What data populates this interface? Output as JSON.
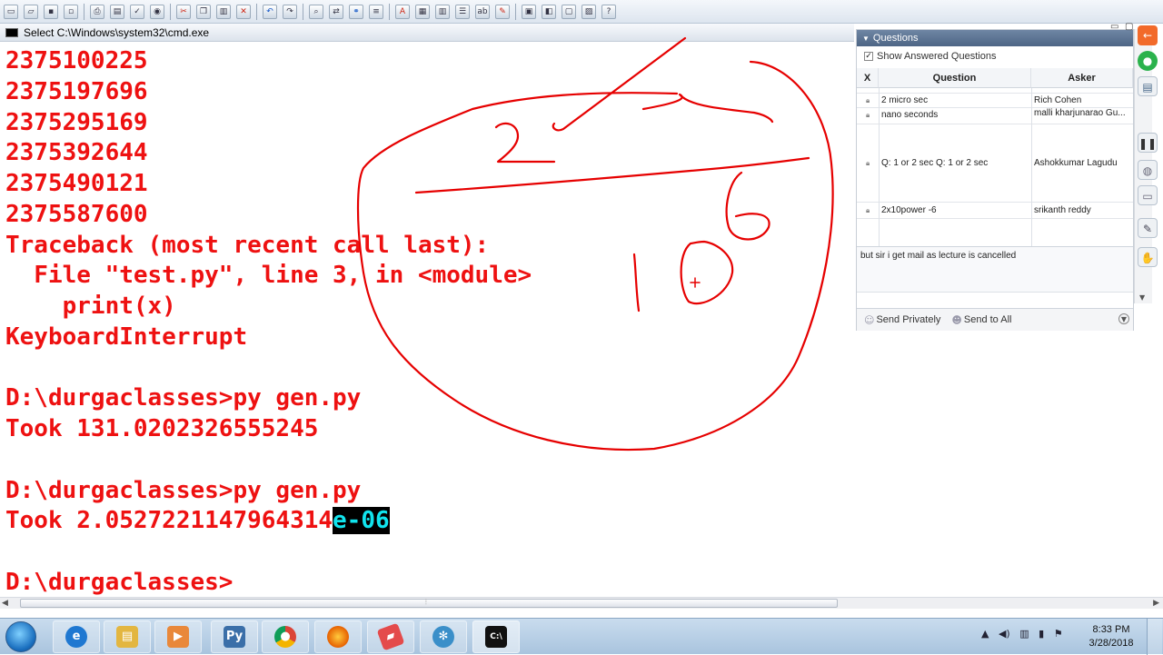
{
  "window": {
    "title": "Select C:\\Windows\\system32\\cmd.exe"
  },
  "terminal": {
    "lines": [
      "2375100225",
      "2375197696",
      "2375295169",
      "2375392644",
      "2375490121",
      "2375587600",
      "Traceback (most recent call last):",
      "  File \"test.py\", line 3, in <module>",
      "    print(x)",
      "KeyboardInterrupt",
      "",
      "D:\\durgaclasses>py gen.py",
      "Took 131.0202326555245",
      "",
      "D:\\durgaclasses>py gen.py",
      "",
      "",
      "D:\\durgaclasses>"
    ],
    "last_took_prefix": "Took 2.0527221147964314",
    "last_took_highlight": "e-06"
  },
  "questions_panel": {
    "title": "Questions",
    "show_answered_label": "Show Answered Questions",
    "show_answered_checked": true,
    "columns": {
      "x": "X",
      "question": "Question",
      "asker": "Asker"
    },
    "rows": [
      {
        "question": "2 micro sec",
        "asker": "Rich Cohen"
      },
      {
        "question": "nano  seconds",
        "asker": "malli kharjunarao Gu..."
      },
      {
        "question": "Q: 1 or 2 sec      Q: 1 or 2 sec",
        "asker": "Ashokkumar Lagudu"
      },
      {
        "question": "2x10power -6",
        "asker": "srikanth reddy"
      }
    ],
    "selected_text": "but sir i get mail as lecture is cancelled",
    "send_privately": "Send Privately",
    "send_to_all": "Send to All"
  },
  "taskbar": {
    "time": "8:33 PM",
    "date": "3/28/2018"
  },
  "colors": {
    "terminal_text": "#ee1111",
    "highlight_fg": "#11e4ee",
    "ink": "#e60000",
    "panel_header": "#5a7192"
  },
  "icons": {
    "taskbar": [
      "ie-icon",
      "file-explorer-icon",
      "media-player-icon",
      "python-icon",
      "chrome-icon",
      "firefox-icon",
      "eraser-icon",
      "settings-icon",
      "cmd-icon"
    ],
    "right_tools": [
      "microphone-icon",
      "chat-icon",
      "pause-icon",
      "mouse-icon",
      "monitor-icon",
      "pen-icon",
      "hand-icon"
    ]
  }
}
